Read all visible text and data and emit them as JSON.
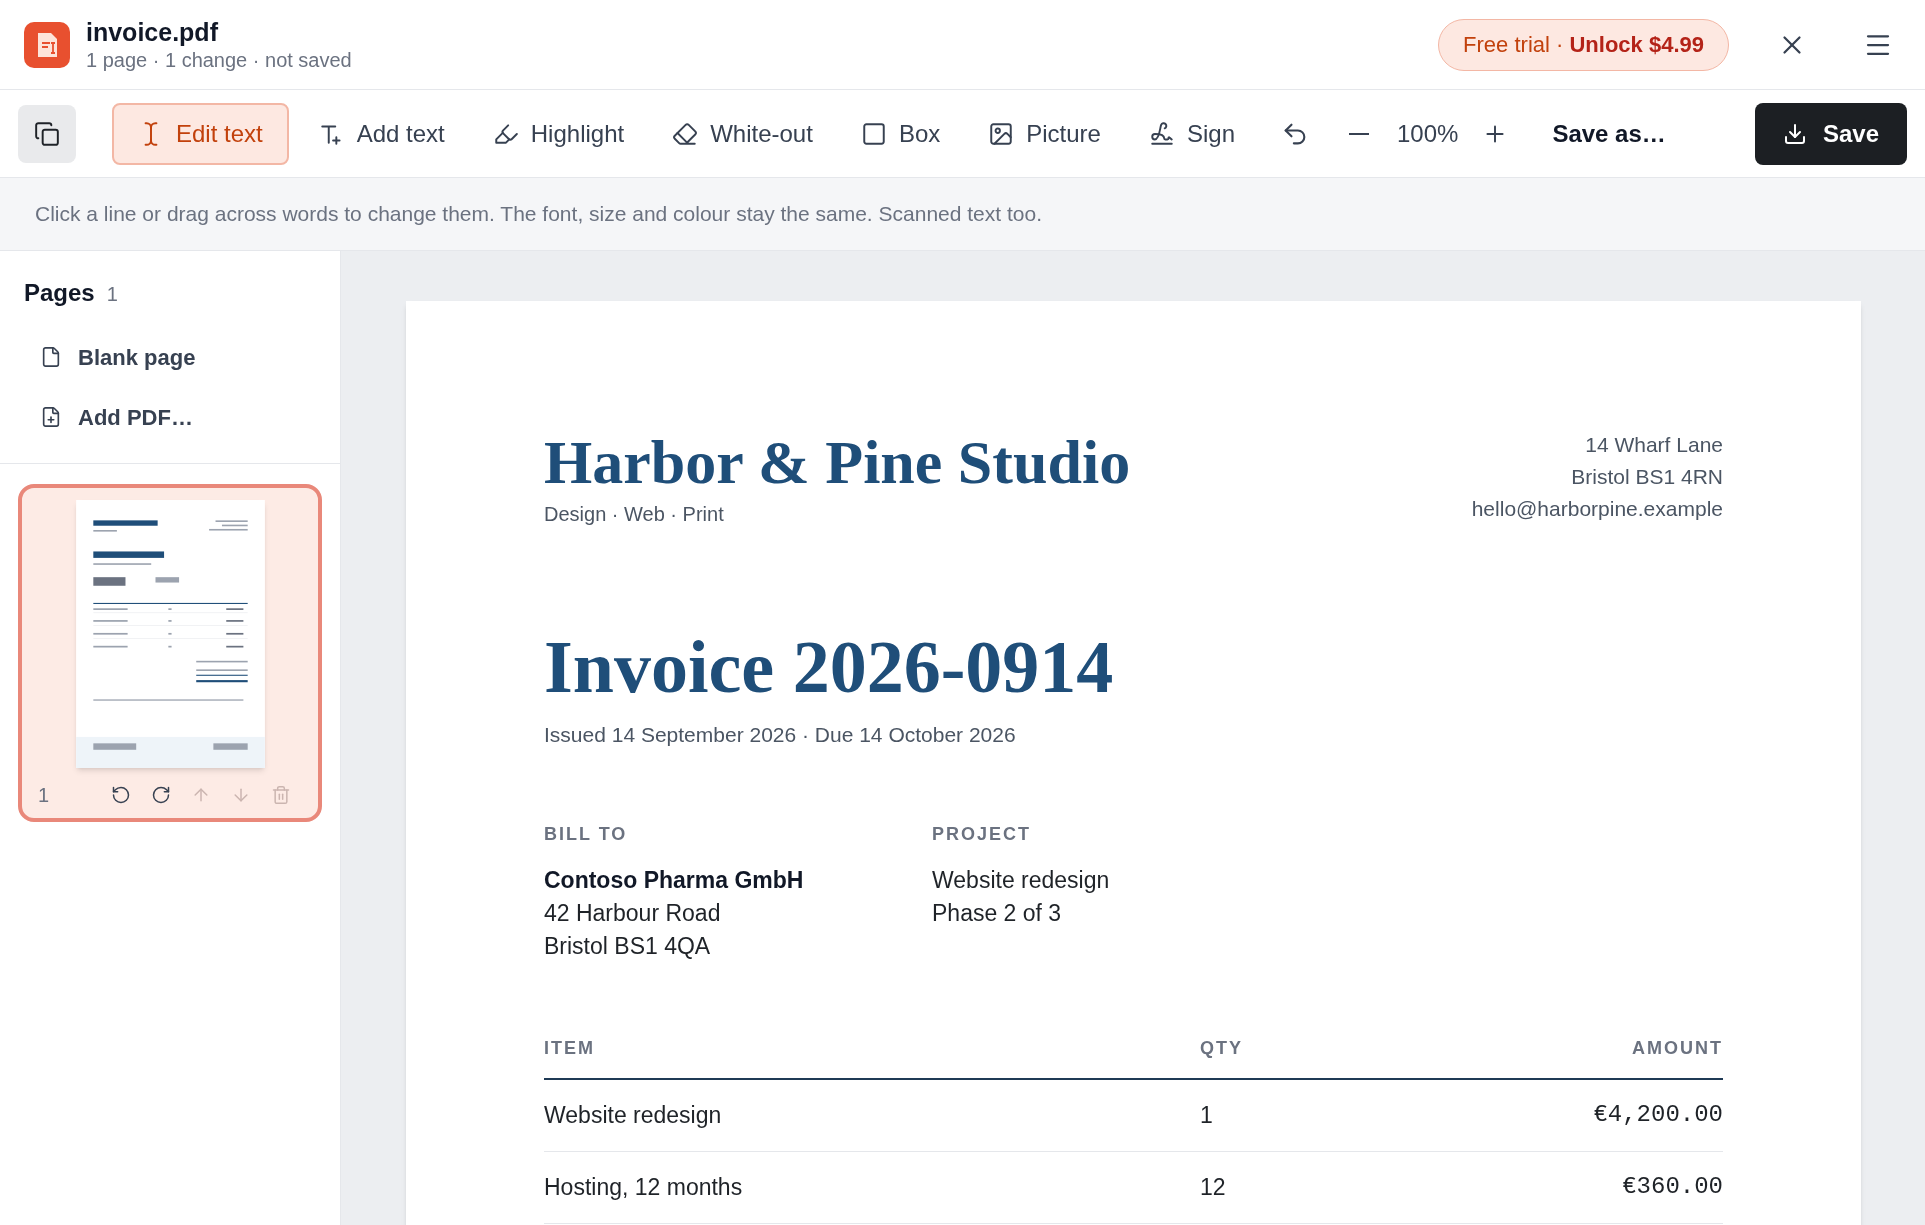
{
  "app": {
    "file_name": "invoice.pdf",
    "status": "1 page · 1 change · not saved"
  },
  "trial": {
    "label": "Free trial ·",
    "action": "Unlock $4.99"
  },
  "toolbar": {
    "tools": [
      {
        "kind": "edit-text",
        "label": "Edit text",
        "selected": true
      },
      {
        "kind": "add-text",
        "label": "Add text",
        "selected": false
      },
      {
        "kind": "highlight",
        "label": "Highlight",
        "selected": false
      },
      {
        "kind": "white-out",
        "label": "White-out",
        "selected": false
      },
      {
        "kind": "box",
        "label": "Box",
        "selected": false
      },
      {
        "kind": "picture",
        "label": "Picture",
        "selected": false
      },
      {
        "kind": "sign",
        "label": "Sign",
        "selected": false
      }
    ],
    "zoom": "100%",
    "save_as": "Save as…",
    "save": "Save"
  },
  "hint": "Click a line or drag across words to change them. The font, size and colour stay the same. Scanned text too.",
  "sidebar": {
    "title": "Pages",
    "count": "1",
    "actions": [
      {
        "kind": "blank",
        "label": "Blank page"
      },
      {
        "kind": "add-pdf",
        "label": "Add PDF…"
      }
    ],
    "pages": [
      {
        "number": "1",
        "selected": true,
        "actions": [
          {
            "kind": "rotate-left",
            "disabled": false
          },
          {
            "kind": "rotate-right",
            "disabled": false
          },
          {
            "kind": "move-up",
            "disabled": true
          },
          {
            "kind": "move-down",
            "disabled": true
          },
          {
            "kind": "delete",
            "disabled": true
          }
        ]
      }
    ]
  },
  "document": {
    "company": {
      "name": "Harbor & Pine Studio",
      "tagline": "Design · Web · Print",
      "address": [
        "14 Wharf Lane",
        "Bristol BS1 4RN",
        "hello@harborpine.example"
      ]
    },
    "title": "Invoice 2026-0914",
    "dates": "Issued 14 September 2026 · Due 14 October 2026",
    "parties": [
      {
        "heading": "BILL TO",
        "lines": [
          "Contoso Pharma GmbH",
          "42 Harbour Road",
          "Bristol BS1 4QA"
        ],
        "first_bold": true
      },
      {
        "heading": "PROJECT",
        "lines": [
          "Website redesign",
          "Phase 2 of 3"
        ],
        "first_bold": false
      }
    ],
    "table": {
      "columns": [
        "ITEM",
        "QTY",
        "AMOUNT"
      ],
      "rows": [
        [
          "Website redesign",
          "1",
          "€4,200.00"
        ],
        [
          "Hosting, 12 months",
          "12",
          "€360.00"
        ]
      ]
    }
  }
}
